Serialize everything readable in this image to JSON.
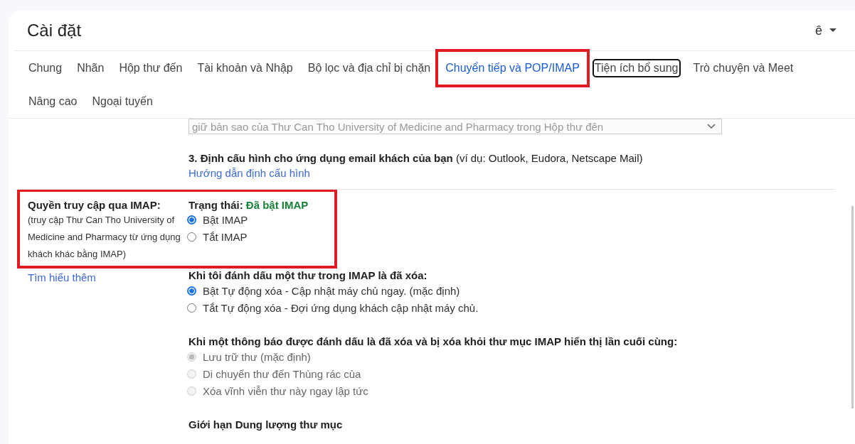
{
  "header": {
    "title": "Cài đặt",
    "account_input": "ê"
  },
  "tab_rows": [
    [
      {
        "label": "Chung",
        "selected": false,
        "focused": false,
        "highlighted": false
      },
      {
        "label": "Nhãn",
        "selected": false,
        "focused": false,
        "highlighted": false
      },
      {
        "label": "Hộp thư đến",
        "selected": false,
        "focused": false,
        "highlighted": false
      },
      {
        "label": "Tài khoản và Nhập",
        "selected": false,
        "focused": false,
        "highlighted": false
      },
      {
        "label": "Bộ lọc và địa chỉ bị chặn",
        "selected": false,
        "focused": false,
        "highlighted": false
      },
      {
        "label": "Chuyển tiếp và POP/IMAP",
        "selected": true,
        "focused": false,
        "highlighted": true
      },
      {
        "label": "Tiện ích bổ sung",
        "selected": false,
        "focused": true,
        "highlighted": false
      },
      {
        "label": "Trò chuyện và Meet",
        "selected": false,
        "focused": false,
        "highlighted": false
      }
    ],
    [
      {
        "label": "Nâng cao",
        "selected": false,
        "focused": false,
        "highlighted": false
      },
      {
        "label": "Ngoại tuyến",
        "selected": false,
        "focused": false,
        "highlighted": false
      }
    ]
  ],
  "pop_tail": {
    "dropdown": {
      "value": "giữ bản sao của Thư Can Tho University of Medicine and Pharmacy trong Hộp thư đên",
      "disabled": true
    },
    "step_text": "**3. Định cấu hình cho ứng dụng email khách của bạn** (ví dụ: Outlook, Eudora, Netscape Mail)",
    "link": "Hướng dẫn định cấu hình"
  },
  "imap": {
    "highlighted": true,
    "label": "Quyền truy cập qua IMAP:",
    "description": "(truy cập Thư Can Tho University of Medicine and Pharmacy từ ứng dụng khách khác bằng IMAP)",
    "learn_more": "Tìm hiểu thêm",
    "status_label": "Trạng thái:",
    "status_value": "Đã bật IMAP",
    "options": [
      {
        "label": "Bật IMAP",
        "selected": true
      },
      {
        "label": "Tắt IMAP",
        "selected": false
      }
    ]
  },
  "option_groups": [
    {
      "heading": "Khi tôi đánh dấu một thư trong IMAP là đã xóa:",
      "options": [
        {
          "label": "Bật Tự động xóa - Cập nhật máy chủ ngay. (mặc định)",
          "selected": true
        },
        {
          "label": "Tắt Tự động xóa - Đợi ứng dụng khách cập nhật máy chủ.",
          "selected": false
        }
      ]
    },
    {
      "heading": "Khi một thông báo được đánh dấu là đã xóa và bị xóa khỏi thư mục IMAP hiển thị lần cuối cùng:",
      "disabled": true,
      "options": [
        {
          "label": "Lưu trữ thư (mặc định)",
          "selected": true
        },
        {
          "label": "Di chuyển thư đến Thùng rác của",
          "selected": false
        },
        {
          "label": "Xóa vĩnh viễn thư này ngay lập tức",
          "selected": false
        }
      ]
    },
    {
      "heading": "Giới hạn Dung lượng thư mục"
    }
  ]
}
